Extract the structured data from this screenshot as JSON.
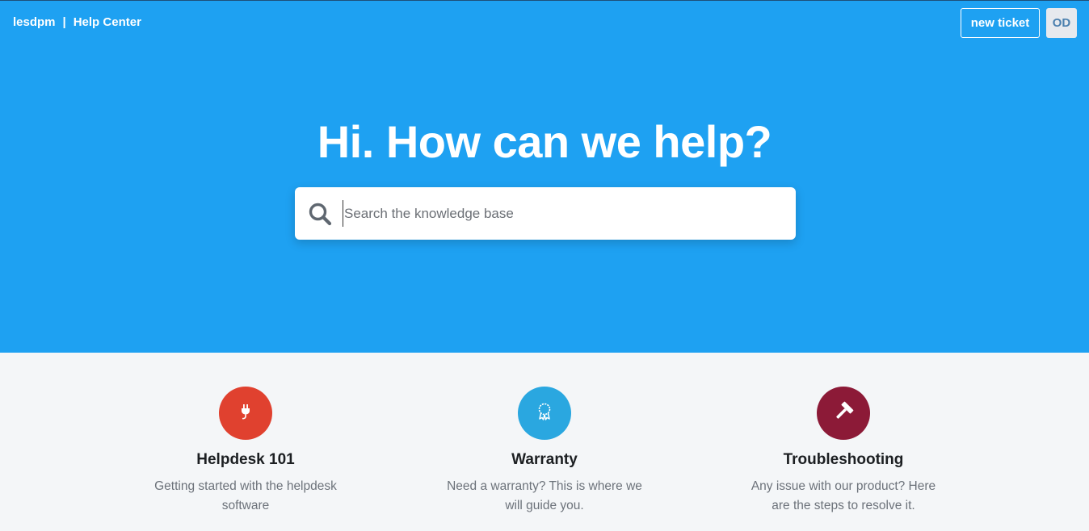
{
  "header": {
    "brand_name": "lesdpm",
    "separator": "|",
    "section": "Help Center",
    "new_ticket_label": "new ticket",
    "avatar_initials": "OD"
  },
  "hero": {
    "title": "Hi. How can we help?"
  },
  "search": {
    "placeholder": "Search the knowledge base",
    "value": ""
  },
  "categories": [
    {
      "title": "Helpdesk 101",
      "description": "Getting started with the helpdesk software",
      "icon": "plug-icon",
      "color": "#e0412f"
    },
    {
      "title": "Warranty",
      "description": "Need a warranty? This is where we will guide you.",
      "icon": "ribbon-badge-icon",
      "color": "#2aa7e0"
    },
    {
      "title": "Troubleshooting",
      "description": "Any issue with our product? Here are the steps to resolve it.",
      "icon": "hammer-icon",
      "color": "#8c1a37"
    }
  ],
  "colors": {
    "hero_bg": "#1ea1f2",
    "page_bg": "#f4f6f8"
  }
}
